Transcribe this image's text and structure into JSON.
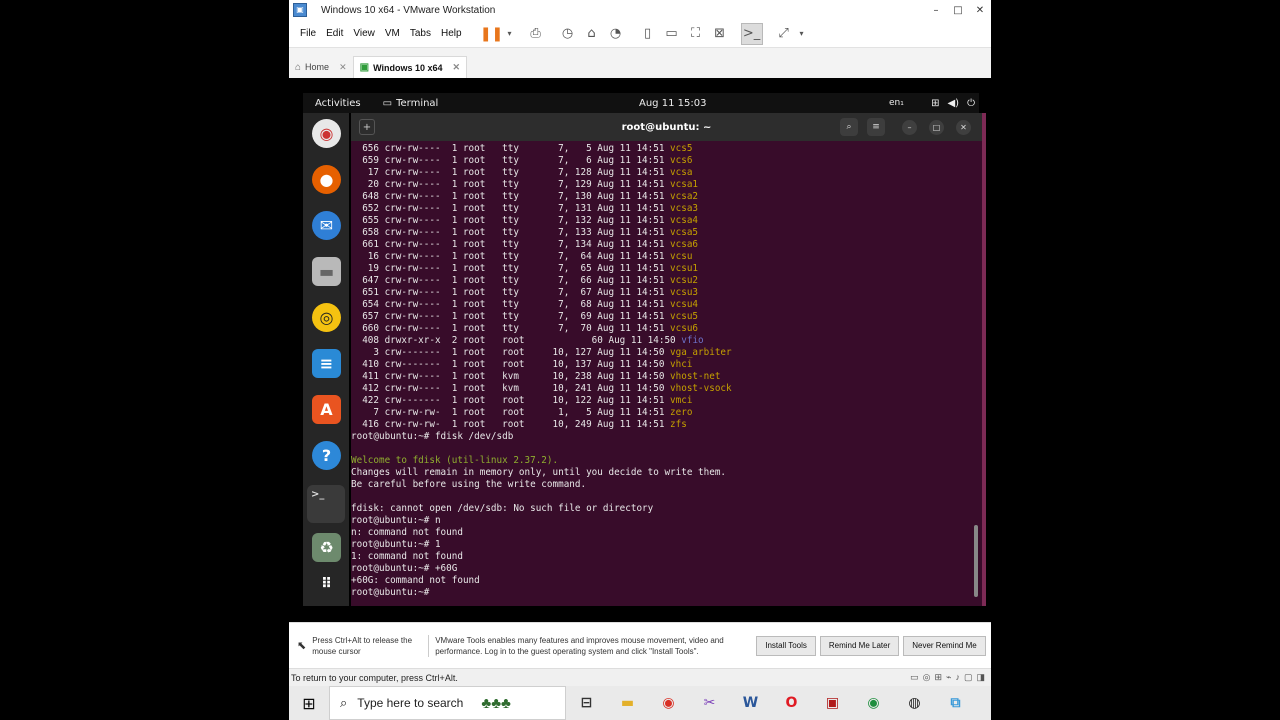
{
  "window": {
    "title": "Windows 10 x64 - VMware Workstation",
    "controls": [
      "–",
      "□",
      "✕"
    ]
  },
  "menubar": {
    "items": [
      "File",
      "Edit",
      "View",
      "VM",
      "Tabs",
      "Help"
    ]
  },
  "tabs": [
    {
      "label": "Home",
      "icon": "home-icon"
    },
    {
      "label": "Windows 10 x64",
      "icon": "vm-icon",
      "active": true
    }
  ],
  "gnome": {
    "activities": "Activities",
    "app": "Terminal",
    "clock": "Aug 11  15:03",
    "lang": "en₁"
  },
  "terminal": {
    "title": "root@ubuntu: ~",
    "lines": [
      {
        "t": "  656 crw-rw----  1 root   tty       7,   5 Aug 11 14:51 ",
        "n": "vcs5",
        "c": "cbg"
      },
      {
        "t": "  659 crw-rw----  1 root   tty       7,   6 Aug 11 14:51 ",
        "n": "vcs6",
        "c": "cbg"
      },
      {
        "t": "   17 crw-rw----  1 root   tty       7, 128 Aug 11 14:51 ",
        "n": "vcsa",
        "c": "cbg"
      },
      {
        "t": "   20 crw-rw----  1 root   tty       7, 129 Aug 11 14:51 ",
        "n": "vcsa1",
        "c": "cbg"
      },
      {
        "t": "  648 crw-rw----  1 root   tty       7, 130 Aug 11 14:51 ",
        "n": "vcsa2",
        "c": "cbg"
      },
      {
        "t": "  652 crw-rw----  1 root   tty       7, 131 Aug 11 14:51 ",
        "n": "vcsa3",
        "c": "cbg"
      },
      {
        "t": "  655 crw-rw----  1 root   tty       7, 132 Aug 11 14:51 ",
        "n": "vcsa4",
        "c": "cbg"
      },
      {
        "t": "  658 crw-rw----  1 root   tty       7, 133 Aug 11 14:51 ",
        "n": "vcsa5",
        "c": "cbg"
      },
      {
        "t": "  661 crw-rw----  1 root   tty       7, 134 Aug 11 14:51 ",
        "n": "vcsa6",
        "c": "cbg"
      },
      {
        "t": "   16 crw-rw----  1 root   tty       7,  64 Aug 11 14:51 ",
        "n": "vcsu",
        "c": "cbg"
      },
      {
        "t": "   19 crw-rw----  1 root   tty       7,  65 Aug 11 14:51 ",
        "n": "vcsu1",
        "c": "cbg"
      },
      {
        "t": "  647 crw-rw----  1 root   tty       7,  66 Aug 11 14:51 ",
        "n": "vcsu2",
        "c": "cbg"
      },
      {
        "t": "  651 crw-rw----  1 root   tty       7,  67 Aug 11 14:51 ",
        "n": "vcsu3",
        "c": "cbg"
      },
      {
        "t": "  654 crw-rw----  1 root   tty       7,  68 Aug 11 14:51 ",
        "n": "vcsu4",
        "c": "cbg"
      },
      {
        "t": "  657 crw-rw----  1 root   tty       7,  69 Aug 11 14:51 ",
        "n": "vcsu5",
        "c": "cbg"
      },
      {
        "t": "  660 crw-rw----  1 root   tty       7,  70 Aug 11 14:51 ",
        "n": "vcsu6",
        "c": "cbg"
      },
      {
        "t": "  408 drwxr-xr-x  2 root   root            60 Aug 11 14:50 ",
        "n": "vfio",
        "c": "cb"
      },
      {
        "t": "    3 crw-------  1 root   root     10, 127 Aug 11 14:50 ",
        "n": "vga_arbiter",
        "c": "cbg"
      },
      {
        "t": "  410 crw-------  1 root   root     10, 137 Aug 11 14:50 ",
        "n": "vhci",
        "c": "cbg"
      },
      {
        "t": "  411 crw-rw----  1 root   kvm      10, 238 Aug 11 14:50 ",
        "n": "vhost-net",
        "c": "cbg"
      },
      {
        "t": "  412 crw-rw----  1 root   kvm      10, 241 Aug 11 14:50 ",
        "n": "vhost-vsock",
        "c": "cbg"
      },
      {
        "t": "  422 crw-------  1 root   root     10, 122 Aug 11 14:51 ",
        "n": "vmci",
        "c": "cbg"
      },
      {
        "t": "    7 crw-rw-rw-  1 root   root      1,   5 Aug 11 14:51 ",
        "n": "zero",
        "c": "cbg"
      },
      {
        "t": "  416 crw-rw-rw-  1 root   root     10, 249 Aug 11 14:51 ",
        "n": "zfs",
        "c": "cbg"
      },
      {
        "t": "root@ubuntu:~# fdisk /dev/sdb",
        "n": "",
        "c": ""
      },
      {
        "t": "",
        "n": "",
        "c": ""
      },
      {
        "t": "",
        "n": "Welcome to fdisk (util-linux 2.37.2).",
        "c": "cg"
      },
      {
        "t": "Changes will remain in memory only, until you decide to write them.",
        "n": "",
        "c": ""
      },
      {
        "t": "Be careful before using the write command.",
        "n": "",
        "c": ""
      },
      {
        "t": "",
        "n": "",
        "c": ""
      },
      {
        "t": "fdisk: cannot open /dev/sdb: No such file or directory",
        "n": "",
        "c": ""
      },
      {
        "t": "root@ubuntu:~# n",
        "n": "",
        "c": ""
      },
      {
        "t": "n: command not found",
        "n": "",
        "c": ""
      },
      {
        "t": "root@ubuntu:~# 1",
        "n": "",
        "c": ""
      },
      {
        "t": "1: command not found",
        "n": "",
        "c": ""
      },
      {
        "t": "root@ubuntu:~# +60G",
        "n": "",
        "c": ""
      },
      {
        "t": "+60G: command not found",
        "n": "",
        "c": ""
      },
      {
        "t": "root@ubuntu:~# ",
        "n": "",
        "c": ""
      }
    ]
  },
  "notification": {
    "release_hint": "Press Ctrl+Alt to release the mouse cursor",
    "tools_msg": "VMware Tools enables many features and improves mouse movement, video and performance. Log in to the guest operating system and click \"Install Tools\".",
    "install": "Install Tools",
    "remind": "Remind Me Later",
    "never": "Never Remind Me"
  },
  "status": {
    "text": "To return to your computer, press Ctrl+Alt."
  },
  "taskbar": {
    "search_placeholder": "Type here to search"
  }
}
